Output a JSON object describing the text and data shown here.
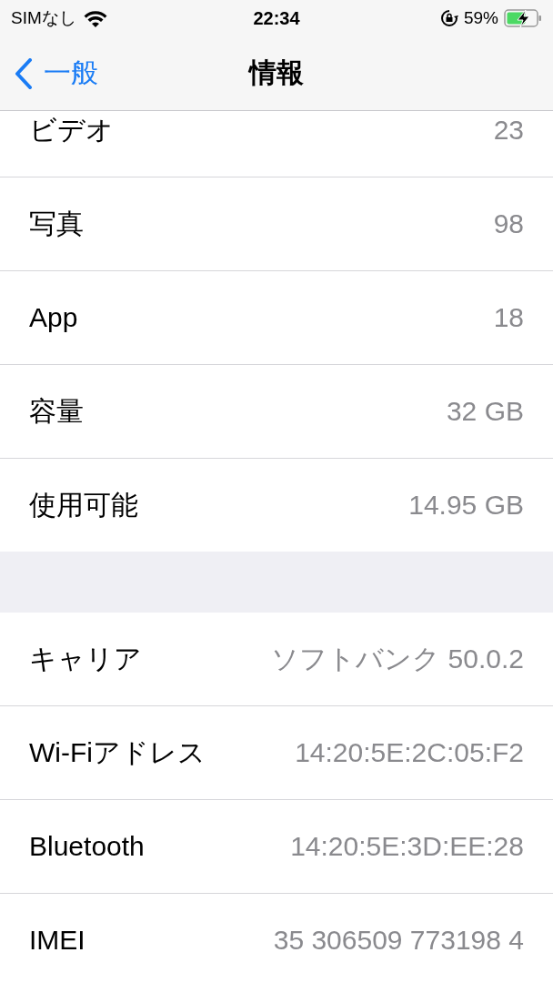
{
  "status_bar": {
    "carrier": "SIMなし",
    "time": "22:34",
    "battery": "59%"
  },
  "nav": {
    "back": "一般",
    "title": "情報"
  },
  "sections": [
    {
      "rows": [
        {
          "label": "ビデオ",
          "value": "23"
        },
        {
          "label": "写真",
          "value": "98"
        },
        {
          "label": "App",
          "value": "18"
        },
        {
          "label": "容量",
          "value": "32 GB"
        },
        {
          "label": "使用可能",
          "value": "14.95 GB"
        }
      ]
    },
    {
      "rows": [
        {
          "label": "キャリア",
          "value": "ソフトバンク 50.0.2"
        },
        {
          "label": "Wi-Fiアドレス",
          "value": "14:20:5E:2C:05:F2"
        },
        {
          "label": "Bluetooth",
          "value": "14:20:5E:3D:EE:28"
        },
        {
          "label": "IMEI",
          "value": "35 306509 773198 4"
        }
      ]
    }
  ]
}
